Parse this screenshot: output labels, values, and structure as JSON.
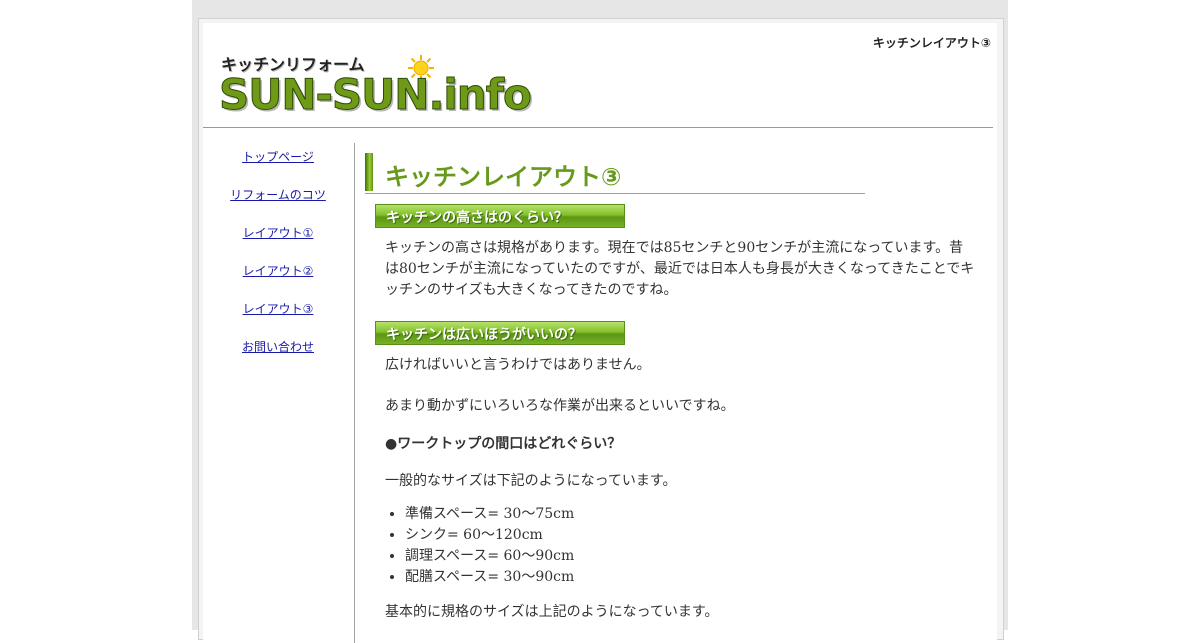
{
  "header": {
    "corner_title": "キッチンレイアウト③",
    "logo_subtitle": "キッチンリフォーム",
    "logo_main": "SUN-SUN.info"
  },
  "sidebar": {
    "items": [
      {
        "label": "トップページ"
      },
      {
        "label": "リフォームのコツ"
      },
      {
        "label": "レイアウト①"
      },
      {
        "label": "レイアウト②"
      },
      {
        "label": "レイアウト③"
      },
      {
        "label": "お問い合わせ"
      }
    ]
  },
  "main": {
    "heading": "キッチンレイアウト③",
    "section1": {
      "title": "キッチンの高さはのくらい？",
      "body": "キッチンの高さは規格があります。現在では85センチと90センチが主流になっています。昔は80センチが主流になっていたのですが、最近では日本人も身長が大きくなってきたことでキッチンのサイズも大きくなってきたのですね。"
    },
    "section2": {
      "title": "キッチンは広いほうがいいの？",
      "p1": "広ければいいと言うわけではありません。",
      "p2": "あまり動かずにいろいろな作業が出来るといいですね。",
      "subheading": "●ワークトップの間口はどれぐらい？",
      "p3": "一般的なサイズは下記のようになっています。",
      "list": [
        "準備スペース= 30～75cm",
        "シンク= 60～120cm",
        "調理スペース= 60～90cm",
        "配膳スペース= 30～90cm"
      ],
      "p4": "基本的に規格のサイズは上記のようになっています。"
    }
  },
  "colors": {
    "brand_green": "#679a1a",
    "link": "#1a1aa8"
  }
}
